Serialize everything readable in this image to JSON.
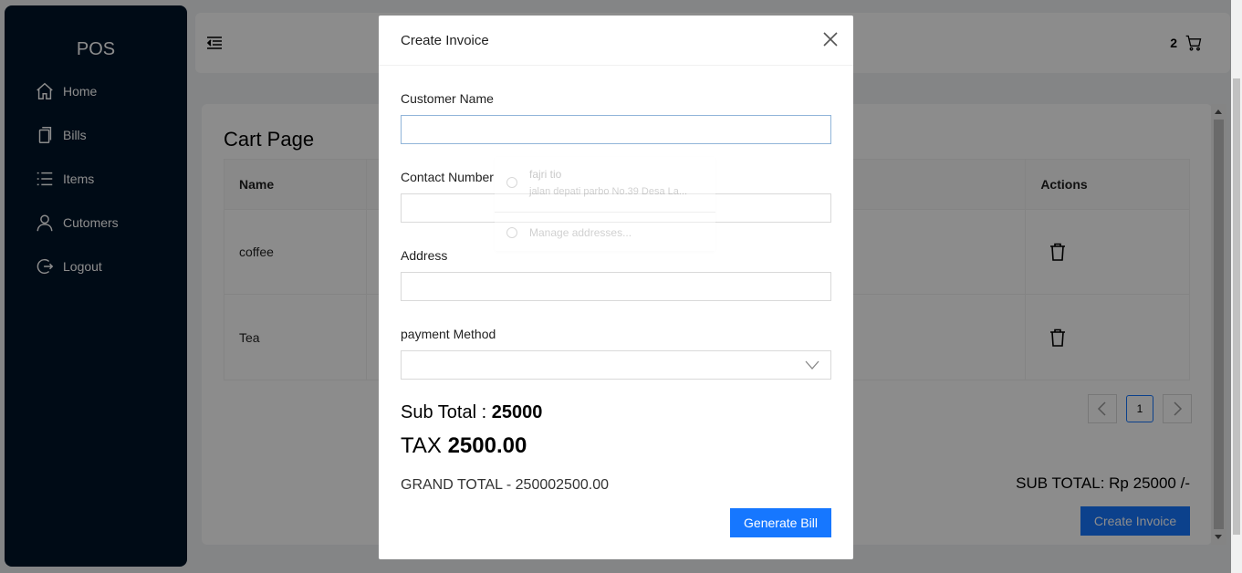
{
  "sidebar": {
    "logo": "POS",
    "items": [
      {
        "label": "Home",
        "icon": "home-icon"
      },
      {
        "label": "Bills",
        "icon": "bills-icon"
      },
      {
        "label": "Items",
        "icon": "list-icon"
      },
      {
        "label": "Cutomers",
        "icon": "user-icon"
      },
      {
        "label": "Logout",
        "icon": "logout-icon"
      }
    ]
  },
  "header": {
    "cart_count": "2"
  },
  "cart_page": {
    "title": "Cart Page",
    "columns": {
      "name": "Name",
      "actions": "Actions"
    },
    "rows": [
      {
        "name": "coffee"
      },
      {
        "name": "Tea"
      }
    ],
    "pagination": {
      "current": "1"
    },
    "subtotal_label": "SUB TOTAL: Rp ",
    "subtotal_value": "25000",
    "subtotal_suffix": " /-",
    "create_invoice_label": "Create Invoice"
  },
  "modal": {
    "title": "Create Invoice",
    "fields": {
      "customer_name_label": "Customer Name",
      "contact_number_label": "Contact Number",
      "address_label": "Address",
      "payment_method_label": "payment Method"
    },
    "sub_total_label": "Sub Total : ",
    "sub_total_value": "25000",
    "tax_label": "TAX ",
    "tax_value": "2500.00",
    "grand_total_label": "GRAND TOTAL - ",
    "grand_total_value": "250002500.00",
    "generate_bill_label": "Generate Bill"
  },
  "autocomplete": {
    "name": "fajri tio",
    "address": "jalan depati parbo No.39 Desa La...",
    "manage": "Manage addresses..."
  },
  "colors": {
    "sidebar_bg": "#001529",
    "primary": "#1677ff"
  }
}
